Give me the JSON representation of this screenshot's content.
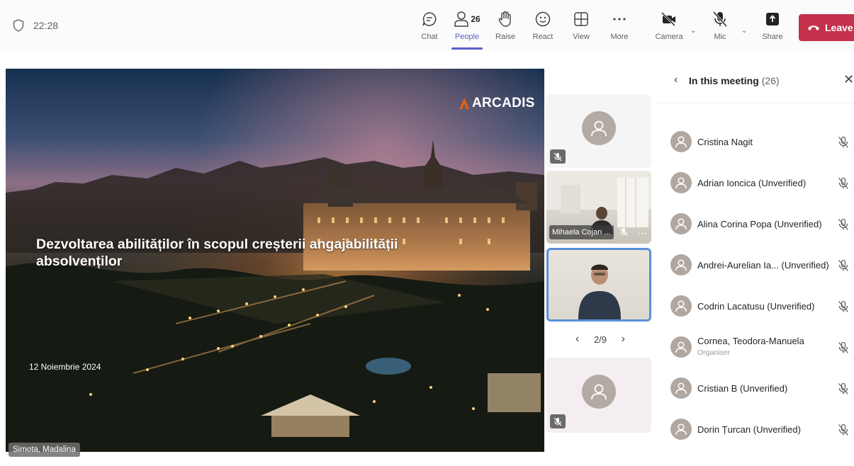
{
  "header": {
    "timer": "22:28",
    "buttons": {
      "chat": "Chat",
      "people": "People",
      "people_count": "26",
      "raise": "Raise",
      "react": "React",
      "view": "View",
      "more": "More",
      "camera": "Camera",
      "mic": "Mic",
      "share": "Share"
    },
    "leave_label": "Leave",
    "accent_color": "#5b5fc7",
    "leave_color": "#c4314b"
  },
  "slide": {
    "logo": "ARCADIS",
    "title": "Dezvoltarea abilităților în scopul creșterii angajabilității absolvenților",
    "date": "12 Noiembrie 2024",
    "presenter": "Simota, Madalina"
  },
  "video_strip": {
    "tiles": [
      {
        "name": ""
      },
      {
        "name": "Mihaela Cojan ..."
      },
      {
        "name": ""
      },
      {
        "name": ""
      }
    ],
    "pager": "2/9"
  },
  "people_panel": {
    "title": "In this meeting",
    "count": "(26)",
    "participants": [
      {
        "name": "Cristina Nagit",
        "role": ""
      },
      {
        "name": "Adrian Ioncica (Unverified)",
        "role": ""
      },
      {
        "name": "Alina Corina Popa (Unverified)",
        "role": ""
      },
      {
        "name": "Andrei-Aurelian Ia... (Unverified)",
        "role": ""
      },
      {
        "name": "Codrin Lacatusu (Unverified)",
        "role": ""
      },
      {
        "name": "Cornea, Teodora-Manuela",
        "role": "Organiser"
      },
      {
        "name": "Cristian B (Unverified)",
        "role": ""
      },
      {
        "name": "Dorin Țurcan (Unverified)",
        "role": ""
      }
    ]
  }
}
